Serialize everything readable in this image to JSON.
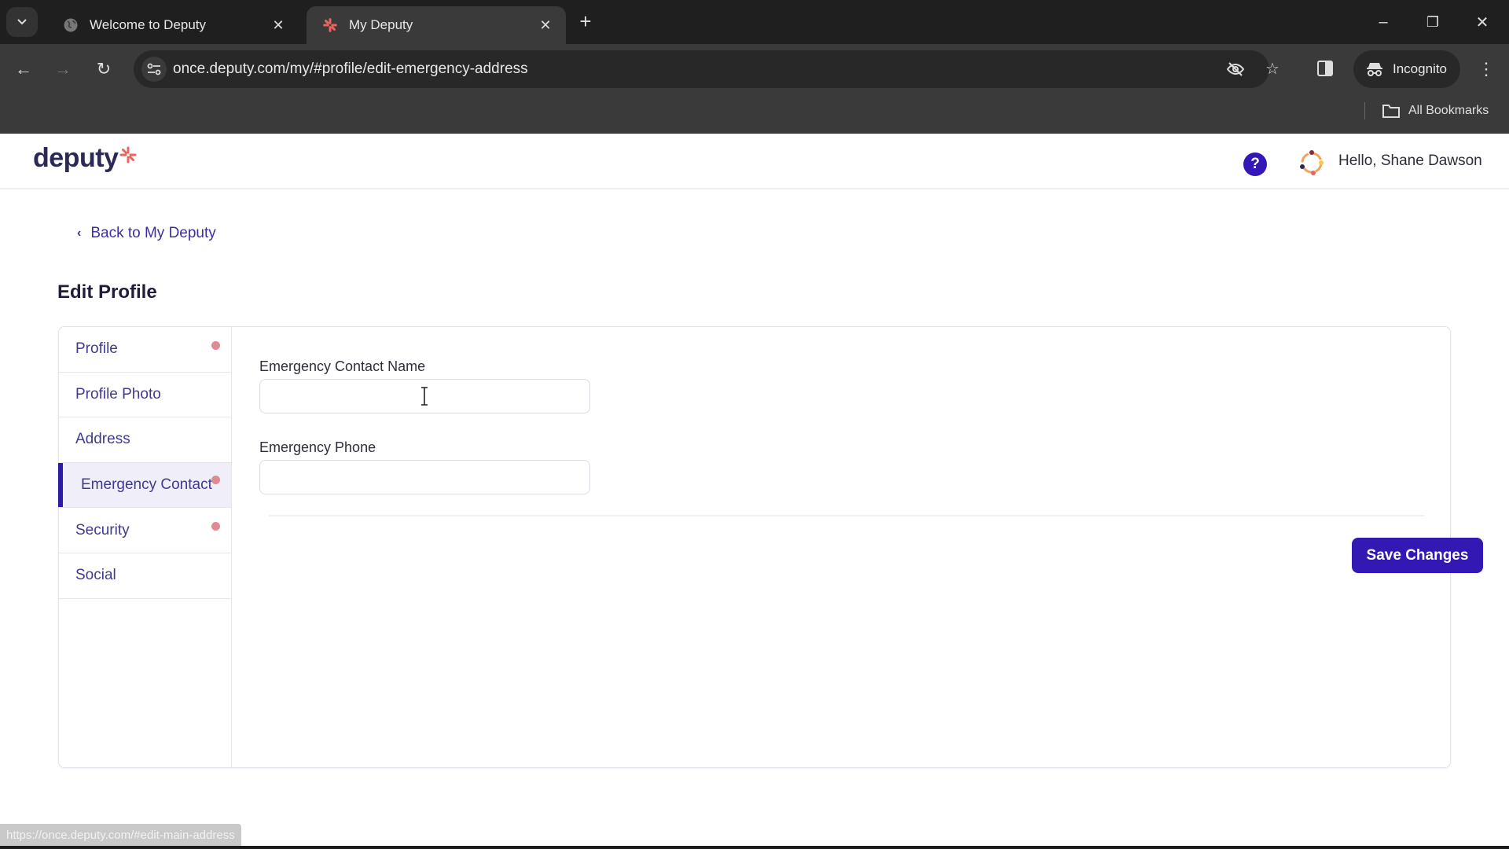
{
  "browser": {
    "tabs": [
      {
        "title": "Welcome to Deputy",
        "icon": "globe-icon",
        "active": false
      },
      {
        "title": "My Deputy",
        "icon": "deputy-favicon",
        "active": true
      }
    ],
    "new_tab_label": "+",
    "url": "once.deputy.com/my/#profile/edit-emergency-address",
    "incognito_label": "Incognito",
    "all_bookmarks_label": "All Bookmarks",
    "window_controls": {
      "minimize": "–",
      "restore": "❐",
      "close": "✕"
    },
    "status_url": "https://once.deputy.com/#edit-main-address"
  },
  "app": {
    "logo_text": "deputy",
    "brand_color": "#3418b4",
    "accent_color": "#e9645c",
    "help_label": "?",
    "greeting": "Hello, Shane Dawson"
  },
  "page": {
    "back_link": "Back to My Deputy",
    "title": "Edit Profile"
  },
  "sidebar": {
    "items": [
      {
        "label": "Profile",
        "has_alert": true,
        "active": false
      },
      {
        "label": "Profile Photo",
        "has_alert": false,
        "active": false
      },
      {
        "label": "Address",
        "has_alert": false,
        "active": false
      },
      {
        "label": "Emergency Contact",
        "has_alert": true,
        "active": true
      },
      {
        "label": "Security",
        "has_alert": true,
        "active": false
      },
      {
        "label": "Social",
        "has_alert": false,
        "active": false
      }
    ]
  },
  "form": {
    "fields": [
      {
        "label": "Emergency Contact Name",
        "value": "",
        "placeholder": ""
      },
      {
        "label": "Emergency Phone",
        "value": "",
        "placeholder": ""
      }
    ],
    "save_label": "Save Changes"
  }
}
